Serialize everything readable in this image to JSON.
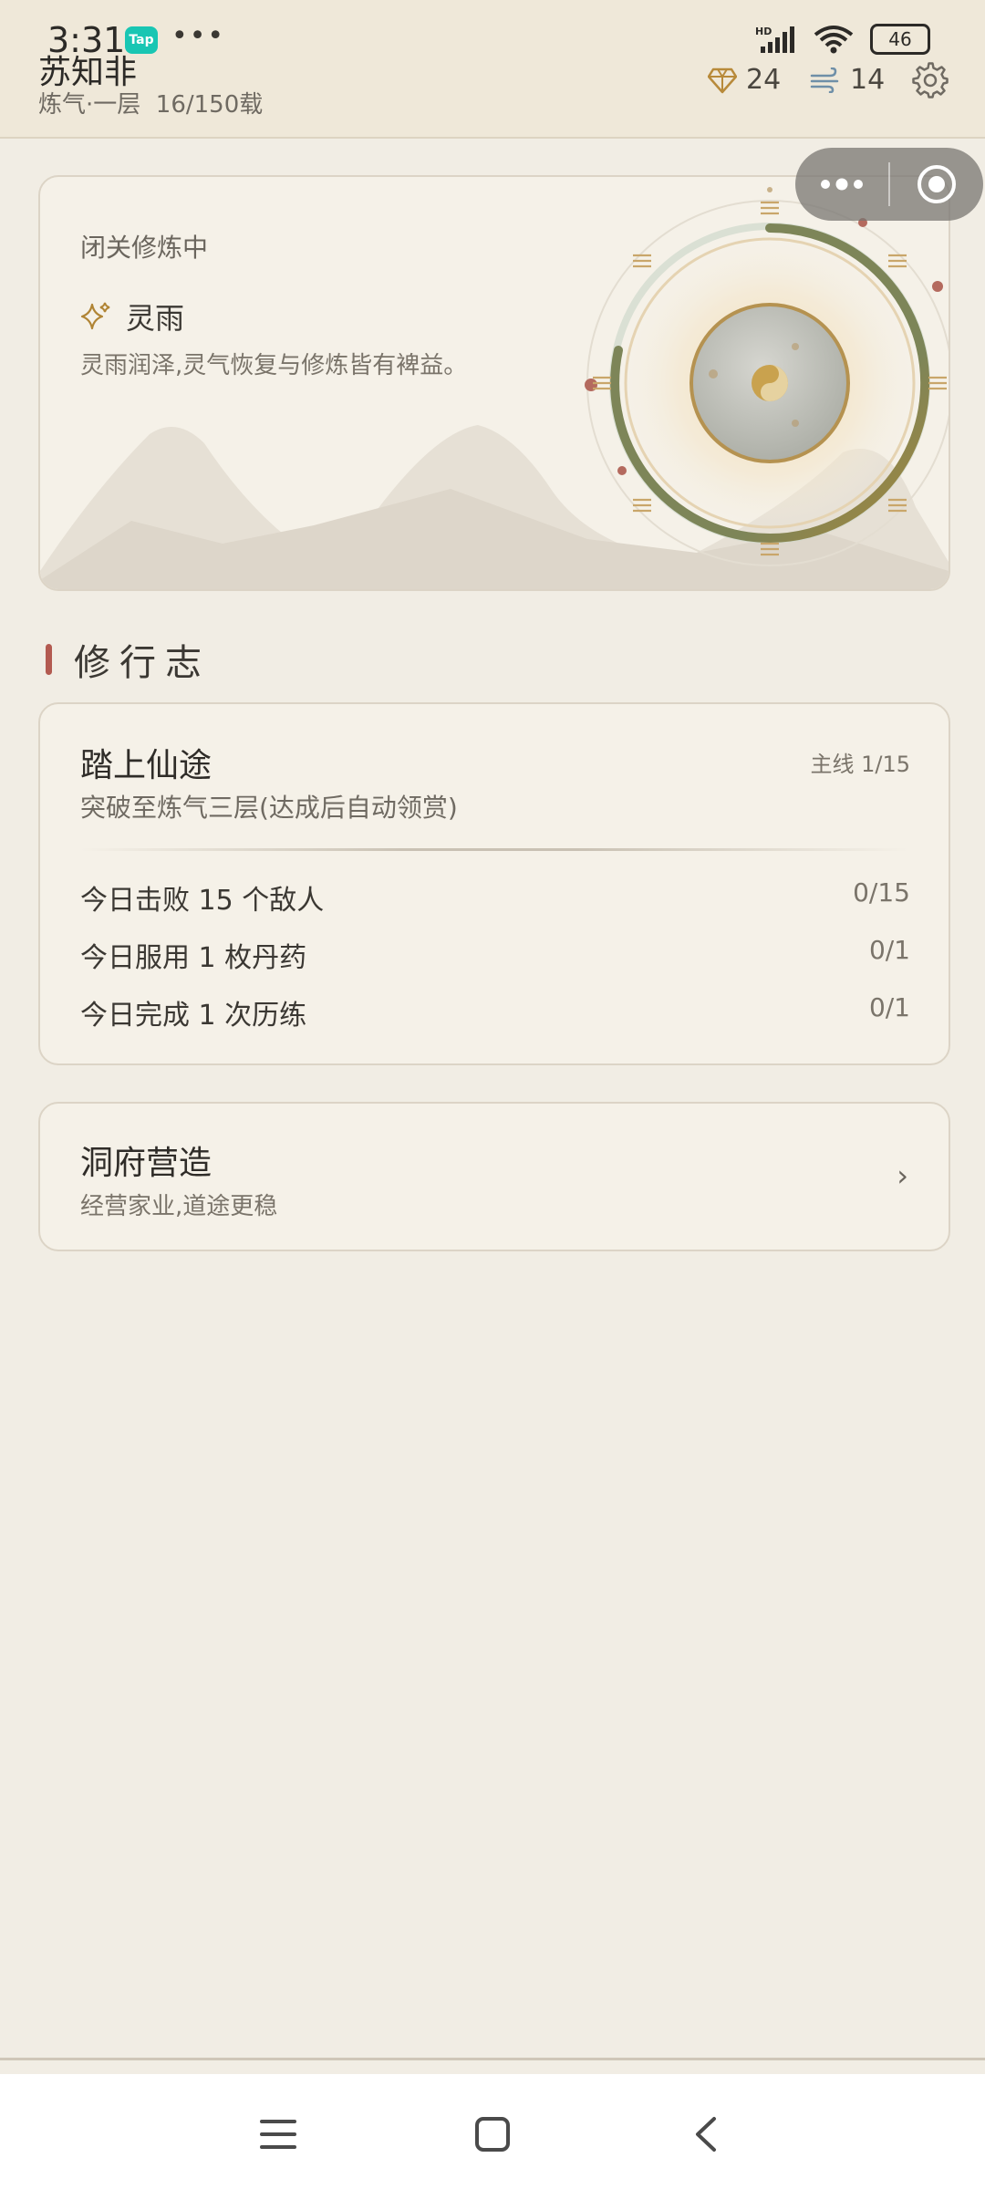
{
  "status_bar": {
    "time": "3:31",
    "app_badge": "Tap",
    "more": "•••",
    "battery": "46"
  },
  "header": {
    "player_name": "苏知非",
    "realm": "炼气·一层",
    "lifespan": "16/150载",
    "gems": "24",
    "spirit": "14"
  },
  "retreat": {
    "title": "闭关修炼中",
    "weather_name": "灵雨",
    "weather_desc": "灵雨润泽,灵气恢复与修炼皆有裨益。",
    "progress": 0.7
  },
  "section": {
    "title": "修行志"
  },
  "quest": {
    "title": "踏上仙途",
    "tag": "主线 1/15",
    "desc": "突破至炼气三层(达成后自动领赏)",
    "dailies": [
      {
        "label": "今日击败 15 个敌人",
        "progress": "0/15"
      },
      {
        "label": "今日服用 1 枚丹药",
        "progress": "0/1"
      },
      {
        "label": "今日完成 1 次历练",
        "progress": "0/1"
      }
    ]
  },
  "cave": {
    "title": "洞府营造",
    "subtitle": "经营家业,道途更稳",
    "chevron": "›"
  },
  "colors": {
    "accent_red": "#b35a50",
    "ring_green": "#7d8558",
    "ring_gold": "#a8863a"
  }
}
